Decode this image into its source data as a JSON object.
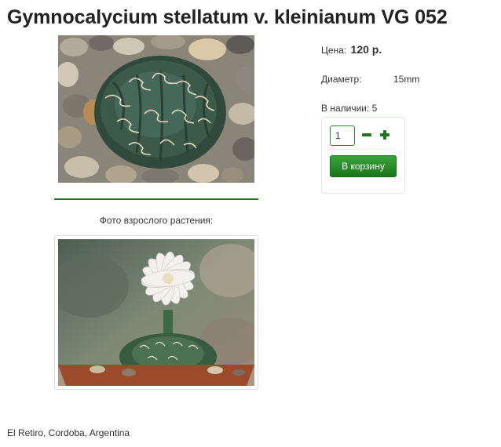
{
  "product": {
    "title": "Gymnocalycium stellatum v. kleinianum VG 052",
    "main_photo_icon": "cactus-photo",
    "adult_caption": "Фото взрослого растения:",
    "adult_photo_icon": "flowering-cactus-photo",
    "origin": "El Retiro, Cordoba, Argentina"
  },
  "info": {
    "price_label": "Цена:",
    "price_value": "120 р.",
    "diameter_label": "Диаметр:",
    "diameter_value": "15mm",
    "stock_label": "В наличии: 5"
  },
  "buy": {
    "quantity": "1",
    "minus_icon": "minus-icon",
    "plus_icon": "plus-icon",
    "cart_label": "В корзину"
  },
  "colors": {
    "accent": "#1a7a1a",
    "button_top": "#3aa43a",
    "button_bottom": "#1a761a"
  }
}
